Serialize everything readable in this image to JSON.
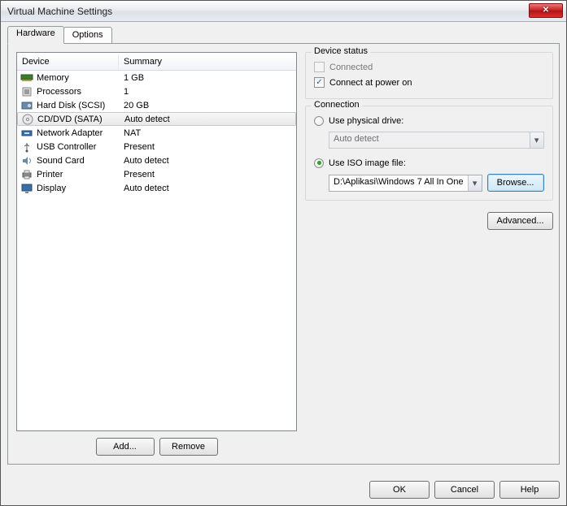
{
  "window": {
    "title": "Virtual Machine Settings"
  },
  "tabs": {
    "hardware": "Hardware",
    "options": "Options"
  },
  "devlist": {
    "header_device": "Device",
    "header_summary": "Summary",
    "rows": [
      {
        "name": "Memory",
        "summary": "1 GB",
        "icon": "memory"
      },
      {
        "name": "Processors",
        "summary": "1",
        "icon": "cpu"
      },
      {
        "name": "Hard Disk (SCSI)",
        "summary": "20 GB",
        "icon": "hdd"
      },
      {
        "name": "CD/DVD (SATA)",
        "summary": "Auto detect",
        "icon": "cd",
        "selected": true
      },
      {
        "name": "Network Adapter",
        "summary": "NAT",
        "icon": "net"
      },
      {
        "name": "USB Controller",
        "summary": "Present",
        "icon": "usb"
      },
      {
        "name": "Sound Card",
        "summary": "Auto detect",
        "icon": "sound"
      },
      {
        "name": "Printer",
        "summary": "Present",
        "icon": "printer"
      },
      {
        "name": "Display",
        "summary": "Auto detect",
        "icon": "display"
      }
    ]
  },
  "buttons": {
    "add": "Add...",
    "remove": "Remove",
    "ok": "OK",
    "cancel": "Cancel",
    "help": "Help",
    "advanced": "Advanced...",
    "browse": "Browse..."
  },
  "status": {
    "legend": "Device status",
    "connected": "Connected",
    "connected_checked": false,
    "connected_enabled": false,
    "power_on": "Connect at power on",
    "power_on_checked": true
  },
  "connection": {
    "legend": "Connection",
    "use_physical": "Use physical drive:",
    "physical_value": "Auto detect",
    "physical_selected": false,
    "use_iso": "Use ISO image file:",
    "iso_selected": true,
    "iso_value": "D:\\Aplikasi\\Windows 7 All In One"
  }
}
